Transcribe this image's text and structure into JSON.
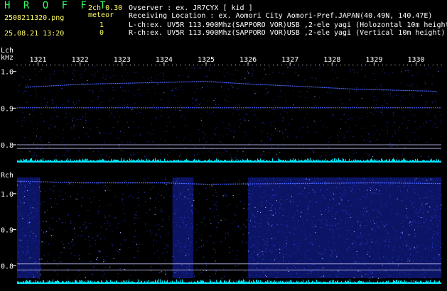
{
  "header": {
    "app_name": "H R O F F T",
    "version": "2ch 0.30",
    "filename": "2508211320.png",
    "type_label": "meteor",
    "datetime": "25.08.21 13:20",
    "count_l": "1",
    "count_r": "0",
    "observer": "Ovserver            : ex. JR7CYX [ kid ]",
    "location": "Receiving Location : ex. Aomori City Aomori-Pref.JAPAN(40.49N, 140.47E)",
    "lch_info": "L-ch:ex. UV5R 113.900Mhz(SAPPORO VOR)USB ,2-ele yagi (Holozontal 10m height",
    "rch_info": "R-ch:ex. UV5R 113.900Mhz(SAPPORO VOR)USB ,2-ele yagi (Vertical 10m height)"
  },
  "colors": {
    "title_green": "#33ff66",
    "text_yellow": "#ffff66",
    "text_white": "#ffffff",
    "noise_blue": "#2d3fd6",
    "trace_blue": "#4a66ff",
    "baseline_cyan": "#00e6ff",
    "ref_line": "#a0a0d0"
  },
  "chart_data": [
    {
      "type": "heatmap",
      "channel_label": "Lch",
      "unit_label": "kHz",
      "x_tick_labels": [
        "1321",
        "1322",
        "1323",
        "1324",
        "1325",
        "1326",
        "1327",
        "1328",
        "1329",
        "1330"
      ],
      "x_range": [
        1320.5,
        1330.6
      ],
      "y_ticks": [
        1.0,
        0.9,
        0.8
      ],
      "y_tick_labels": [
        "1.0",
        "0.9",
        "0.8"
      ],
      "y_range": [
        0.765,
        1.015
      ],
      "reference_lines_khz": [
        0.8,
        0.79
      ],
      "traces": [
        {
          "x": [
            1320.7,
            1322,
            1323.5,
            1325,
            1326,
            1327.5,
            1328.5,
            1330.5
          ],
          "y": [
            0.957,
            0.965,
            0.969,
            0.973,
            0.966,
            0.958,
            0.952,
            0.946
          ]
        },
        {
          "x": [
            1320.5,
            1330.6
          ],
          "y": [
            0.901,
            0.901
          ]
        }
      ],
      "noise_level": 0.22
    },
    {
      "type": "heatmap",
      "channel_label": "Rch",
      "y_ticks": [
        1.0,
        0.9,
        0.8
      ],
      "y_tick_labels": [
        "1.0",
        "0.9",
        "0.8"
      ],
      "y_range": [
        0.765,
        1.045
      ],
      "reference_lines_khz": [
        0.805,
        0.788
      ],
      "traces": [
        {
          "x": [
            1320.5,
            1322,
            1324,
            1325,
            1327,
            1329,
            1330.6
          ],
          "y": [
            1.035,
            1.03,
            1.03,
            1.026,
            1.028,
            1.03,
            1.028
          ]
        }
      ],
      "noise_level": 0.45,
      "bright_bands": [
        [
          1320.5,
          1321.05
        ],
        [
          1324.2,
          1324.7
        ],
        [
          1326.0,
          1330.6
        ]
      ],
      "dim_bands": [
        [
          1323.4,
          1323.5
        ]
      ]
    }
  ]
}
